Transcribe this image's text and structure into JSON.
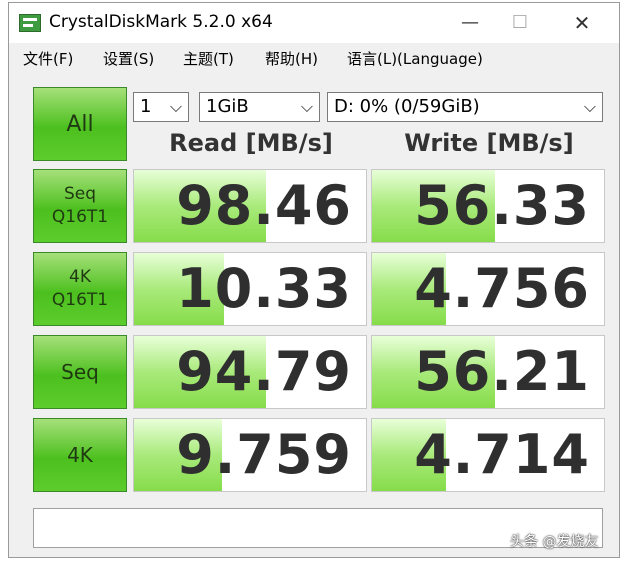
{
  "window": {
    "title": "CrystalDiskMark 5.2.0 x64",
    "minimize": "—",
    "maximize": "☐",
    "close": "✕"
  },
  "menu": {
    "file": "文件(F)",
    "settings": "设置(S)",
    "theme": "主题(T)",
    "help": "帮助(H)",
    "language": "语言(L)(Language)"
  },
  "controls": {
    "all_label": "All",
    "count": "1",
    "size": "1GiB",
    "drive": "D: 0% (0/59GiB)",
    "chevron": "⌵"
  },
  "headers": {
    "read": "Read [MB/s]",
    "write": "Write [MB/s]"
  },
  "rows": [
    {
      "line1": "Seq",
      "line2": "Q16T1",
      "read": "98.46",
      "write": "56.33",
      "read_fill": 0.57,
      "write_fill": 0.53
    },
    {
      "line1": "4K",
      "line2": "Q16T1",
      "read": "10.33",
      "write": "4.756",
      "read_fill": 0.39,
      "write_fill": 0.32
    },
    {
      "line1": "Seq",
      "line2": "",
      "read": "94.79",
      "write": "56.21",
      "read_fill": 0.57,
      "write_fill": 0.53
    },
    {
      "line1": "4K",
      "line2": "",
      "read": "9.759",
      "write": "4.714",
      "read_fill": 0.38,
      "write_fill": 0.32
    }
  ],
  "comment": "",
  "watermark": "头条 @发烧友",
  "colors": {
    "accent_green": "#4cc01e",
    "bar_green": "#86dc4a"
  }
}
